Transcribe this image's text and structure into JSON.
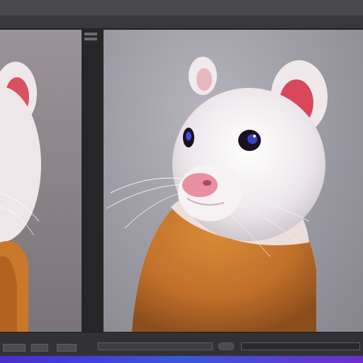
{
  "app": {
    "menu_text": "",
    "window_title": ""
  },
  "panels": {
    "left_preview_label": "",
    "main_preview_label": ""
  },
  "bottom_bar": {
    "left_tab": "",
    "middle_tab": "",
    "right_tab": ""
  },
  "colors": {
    "chrome": "#2b2b2e",
    "accent_strip": "#3b56d8",
    "fur_orange": "#c9782c",
    "fur_white": "#f2eef1",
    "ear_pink": "#d94a5a"
  },
  "icons": [
    "window-controls-icon",
    "play-icon",
    "zoom-icon",
    "settings-icon"
  ]
}
